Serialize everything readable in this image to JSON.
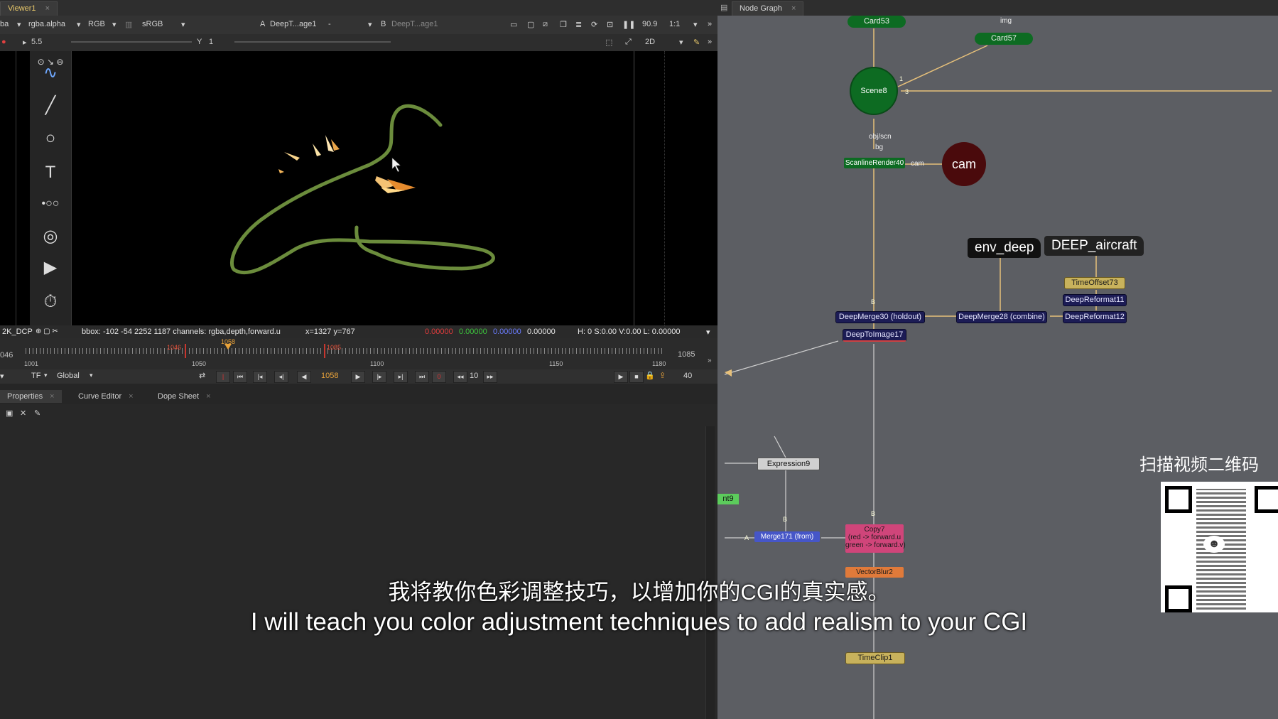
{
  "viewer": {
    "tab_label": "Viewer1",
    "tab_close": "×",
    "toolbar": {
      "layer_left": "ba",
      "channel_alpha": "rgba.alpha",
      "colorspace_rgb": "RGB",
      "lut": "sRGB",
      "input_a_prefix": "A",
      "input_a": "DeepT...age1",
      "input_a_op": "-",
      "input_b_prefix": "B",
      "input_b": "DeepT...age1",
      "zoom_pct": "90.9",
      "zoom_ratio": "1:1"
    },
    "toolbar2": {
      "y_label": "Y",
      "y_value": "1",
      "view_mode": "2D",
      "gain_label": "5.5"
    },
    "info": {
      "format": "2K_DCP",
      "bbox": "bbox: -102 -54 2252 1187 channels: rgba,depth,forward.u",
      "cursor": "x=1327 y=767",
      "r": "0.00000",
      "g": "0.00000",
      "b": "0.00000",
      "a": "0.00000",
      "hsv": "H: 0 S:0.00 V:0.00 L: 0.00000"
    },
    "timeline": {
      "start_left": "046",
      "ticks": [
        "1001",
        "1050",
        "1100",
        "1150",
        "1180"
      ],
      "in_marker": "1046",
      "cur_marker": "1058",
      "out_marker": "1085",
      "end_frame": "1085"
    },
    "playbar": {
      "tf": "TF",
      "scope": "Global",
      "current_frame": "1058",
      "step": "10",
      "fps": "40"
    },
    "panel_tabs": [
      {
        "label": "Properties",
        "active": true
      },
      {
        "label": "Curve Editor",
        "active": false
      },
      {
        "label": "Dope Sheet",
        "active": false
      }
    ]
  },
  "nodegraph": {
    "tab_label": "Node Graph",
    "tab_close": "×",
    "nodes": {
      "card53": "Card53",
      "card57": "Card57",
      "img_label": "img",
      "scene8": "Scene8",
      "scene_input_1": "1",
      "scene_input_3": "3",
      "objscn_label": "obj/scn",
      "bg_label": "bg",
      "scanline": "ScanlineRender40",
      "cam_input": "cam",
      "cam_node": "cam",
      "env_deep": "env_deep",
      "deep_aircraft": "DEEP_aircraft",
      "timeoffset": "TimeOffset73",
      "deepreformat11": "DeepReformat11",
      "deepreformat12": "DeepReformat12",
      "deepmerge30": "DeepMerge30 (holdout)",
      "deepmerge28": "DeepMerge28 (combine)",
      "deeptoimage": "DeepToImage17",
      "expression9": "Expression9",
      "merge171": "Merge171 (from)",
      "copy7_title": "Copy7",
      "copy7_l1": "(red -> forward.u",
      "copy7_l2": "green -> forward.v)",
      "vectorblur": "VectorBlur2",
      "timeclip": "TimeClip1",
      "partial_left": "nt9",
      "b_label": "B",
      "a_label": "A"
    },
    "qr_caption": "扫描视频二维码"
  },
  "subtitles": {
    "zh": "我将教你色彩调整技巧，以增加你的CGI的真实感。",
    "en": "I will teach you color adjustment techniques to add realism to your CGI"
  },
  "colors": {
    "viewer_bg": "#000000",
    "stroke_green": "#6b8c3c",
    "node_green": "#0d6b22",
    "cam_node": "#4a0a0c",
    "deep_node": "#1c1c55",
    "copy_node": "#d0457a",
    "merge_node": "#4656c8",
    "vectorblur_node": "#e07a3a",
    "timeclip_node": "#c8b25c",
    "wire": "#e6c07a"
  }
}
